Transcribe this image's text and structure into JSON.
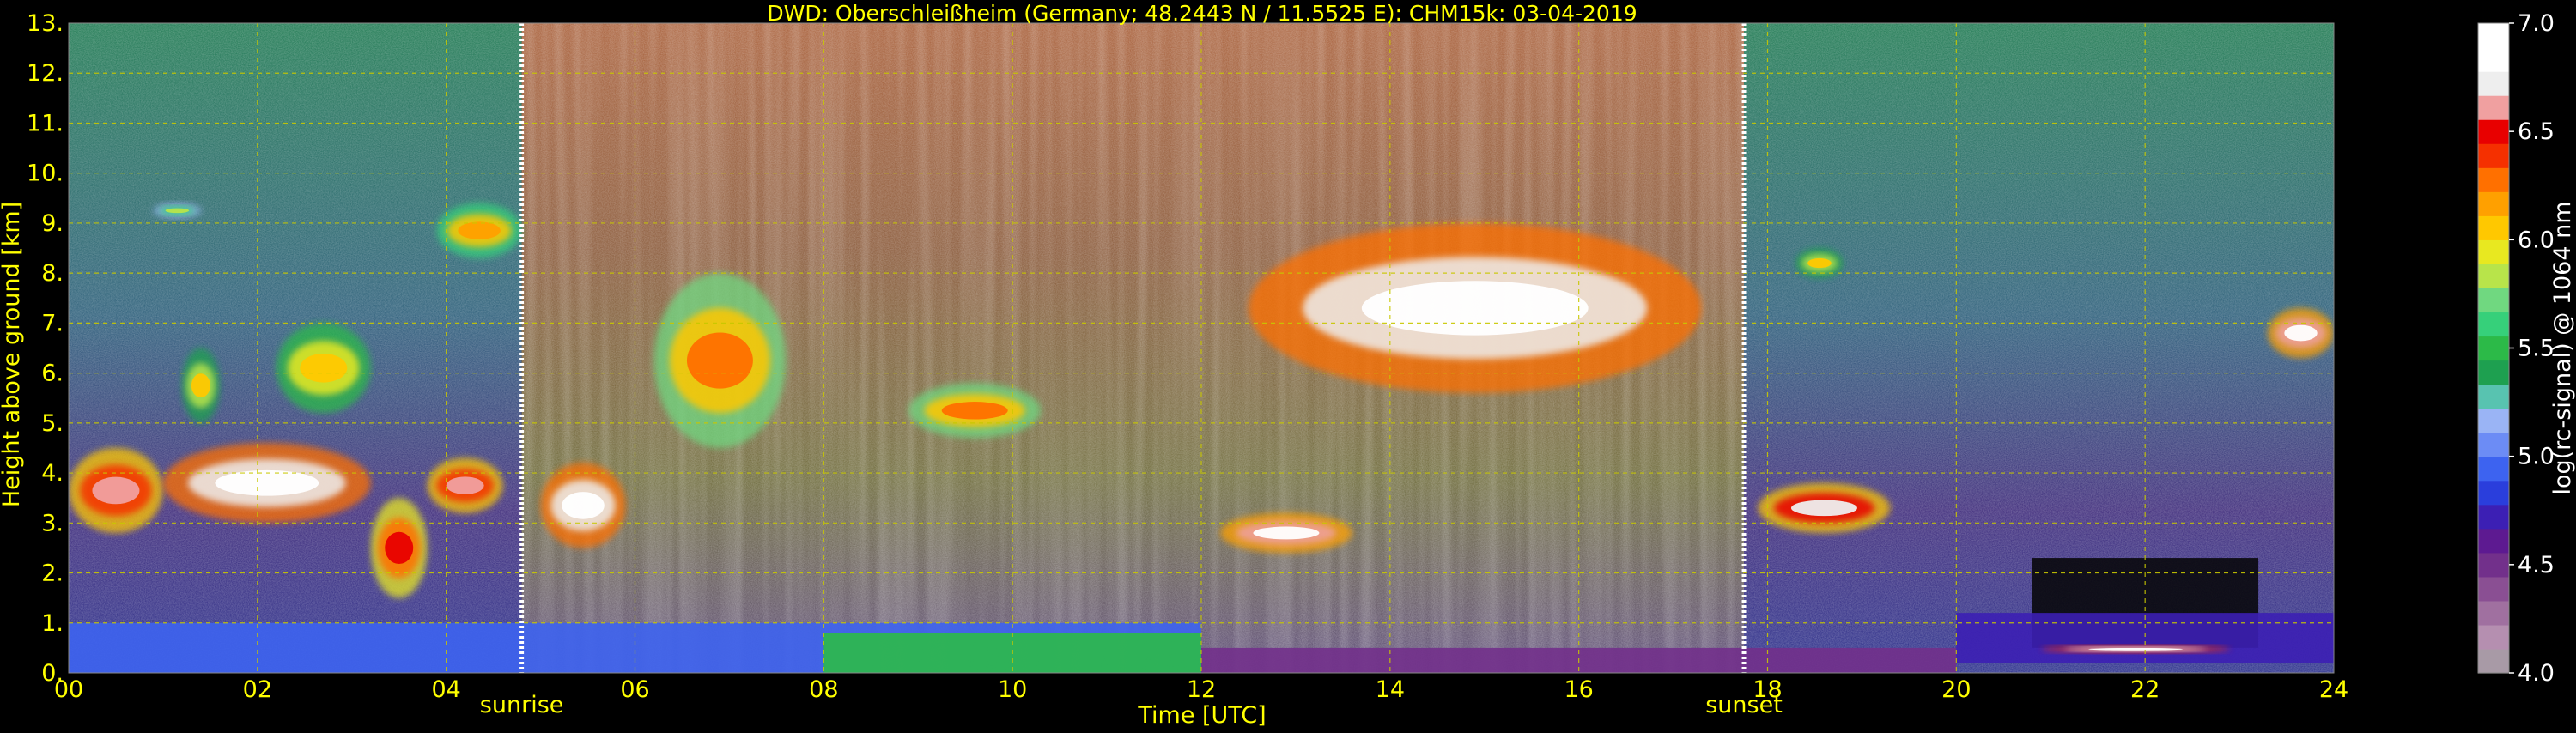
{
  "colors": {
    "background": "#000000",
    "text": "#ffff00",
    "grid": "#c8c800",
    "marker_line": "#ffffff"
  },
  "chart_data": {
    "type": "heatmap",
    "title": "DWD: Oberschleißheim (Germany; 48.2443 N / 11.5525 E):    CHM15k: 03-04-2019",
    "xlabel": "Time [UTC]",
    "ylabel": "Height above ground [km]",
    "xlim": [
      0,
      24
    ],
    "ylim": [
      0,
      13
    ],
    "x_ticks": [
      0,
      2,
      4,
      6,
      8,
      10,
      12,
      14,
      16,
      18,
      20,
      22,
      24
    ],
    "x_tick_labels": [
      "00",
      "02",
      "04",
      "06",
      "08",
      "10",
      "12",
      "14",
      "16",
      "18",
      "20",
      "22",
      "24"
    ],
    "y_ticks": [
      0,
      1,
      2,
      3,
      4,
      5,
      6,
      7,
      8,
      9,
      10,
      11,
      12,
      13
    ],
    "y_tick_labels": [
      "0.",
      "1.",
      "2.",
      "3.",
      "4.",
      "5.",
      "6.",
      "7.",
      "8.",
      "9.",
      "10.",
      "11.",
      "12.",
      "13."
    ],
    "grid": true,
    "colorbar": {
      "label": "log(rc-signal) @ 1064 nm",
      "range": [
        4.0,
        7.0
      ],
      "ticks": [
        4.0,
        4.5,
        5.0,
        5.5,
        6.0,
        6.5,
        7.0
      ],
      "tick_labels": [
        "4.0",
        "4.5",
        "5.0",
        "5.5",
        "6.0",
        "6.5",
        "7.0"
      ],
      "colors": [
        "#a89aa6",
        "#b58fb0",
        "#a070a0",
        "#8a4f93",
        "#72308b",
        "#5d1a91",
        "#3c1fb4",
        "#2a3edc",
        "#3d63f0",
        "#6c8cf5",
        "#9ab4f5",
        "#58c3b0",
        "#1ea050",
        "#2cba48",
        "#36d07a",
        "#70d880",
        "#b8e44a",
        "#e8e820",
        "#ffc800",
        "#ffa000",
        "#ff7000",
        "#f53000",
        "#e80000",
        "#f0a0a0",
        "#eeeeee",
        "#ffffff",
        "#ffffff"
      ]
    },
    "vertical_markers": [
      {
        "label": "sunrise",
        "x": 4.8
      },
      {
        "label": "sunset",
        "x": 17.75
      }
    ],
    "regions": [
      {
        "kind": "background_noise",
        "x": [
          0,
          4.8
        ],
        "y": [
          0,
          13
        ],
        "level": 5.0
      },
      {
        "kind": "background_noise",
        "x": [
          4.8,
          17.75
        ],
        "y": [
          0,
          13
        ],
        "level": 5.8
      },
      {
        "kind": "background_noise",
        "x": [
          17.75,
          24
        ],
        "y": [
          0,
          13
        ],
        "level": 5.0
      },
      {
        "kind": "boundary_layer",
        "x": [
          0,
          12
        ],
        "y": [
          0,
          1
        ],
        "level": 4.9
      },
      {
        "kind": "boundary_layer",
        "x": [
          8,
          12
        ],
        "y": [
          0,
          0.8
        ],
        "level": 5.5
      },
      {
        "kind": "boundary_layer",
        "x": [
          12,
          20
        ],
        "y": [
          0,
          0.5
        ],
        "level": 4.5
      },
      {
        "kind": "cloud",
        "x": [
          0,
          1.0
        ],
        "y": [
          2.8,
          4.5
        ],
        "level": 6.6
      },
      {
        "kind": "cloud",
        "x": [
          1.0,
          3.2
        ],
        "y": [
          3.0,
          4.6
        ],
        "level": 6.9
      },
      {
        "kind": "cloud",
        "x": [
          3.2,
          3.8
        ],
        "y": [
          1.5,
          3.5
        ],
        "level": 6.5
      },
      {
        "kind": "cloud",
        "x": [
          3.8,
          4.6
        ],
        "y": [
          3.2,
          4.3
        ],
        "level": 6.6
      },
      {
        "kind": "cloud",
        "x": [
          2.2,
          3.2
        ],
        "y": [
          5.2,
          7.0
        ],
        "level": 6.1
      },
      {
        "kind": "cloud",
        "x": [
          1.2,
          1.6
        ],
        "y": [
          5.0,
          6.5
        ],
        "level": 6.0
      },
      {
        "kind": "cloud",
        "x": [
          0.9,
          1.4
        ],
        "y": [
          9.1,
          9.4
        ],
        "level": 5.8
      },
      {
        "kind": "cloud",
        "x": [
          3.9,
          4.8
        ],
        "y": [
          8.3,
          9.4
        ],
        "level": 6.2
      },
      {
        "kind": "cloud",
        "x": [
          5.0,
          5.9
        ],
        "y": [
          2.5,
          4.2
        ],
        "level": 6.9
      },
      {
        "kind": "cloud",
        "x": [
          6.2,
          7.6
        ],
        "y": [
          4.5,
          8.0
        ],
        "level": 6.3
      },
      {
        "kind": "cloud",
        "x": [
          8.9,
          10.3
        ],
        "y": [
          4.7,
          5.8
        ],
        "level": 6.3
      },
      {
        "kind": "cloud",
        "x": [
          12.5,
          17.3
        ],
        "y": [
          5.6,
          9.0
        ],
        "level": 6.9
      },
      {
        "kind": "cloud",
        "x": [
          12.2,
          13.6
        ],
        "y": [
          2.4,
          3.2
        ],
        "level": 6.8
      },
      {
        "kind": "cloud",
        "x": [
          17.9,
          19.3
        ],
        "y": [
          2.8,
          3.8
        ],
        "level": 6.7
      },
      {
        "kind": "cloud",
        "x": [
          18.3,
          18.8
        ],
        "y": [
          7.9,
          8.5
        ],
        "level": 6.0
      },
      {
        "kind": "cloud",
        "x": [
          23.3,
          24
        ],
        "y": [
          6.3,
          7.3
        ],
        "level": 6.8
      },
      {
        "kind": "low_signal",
        "x": [
          20.8,
          23.2
        ],
        "y": [
          0.5,
          2.3
        ],
        "level": 4.0
      },
      {
        "kind": "aerosol_layer",
        "x": [
          20,
          24
        ],
        "y": [
          0.2,
          1.2
        ],
        "level": 4.7
      },
      {
        "kind": "cloud",
        "x": [
          20.9,
          22.9
        ],
        "y": [
          0.4,
          0.55
        ],
        "level": 7.0
      }
    ]
  }
}
